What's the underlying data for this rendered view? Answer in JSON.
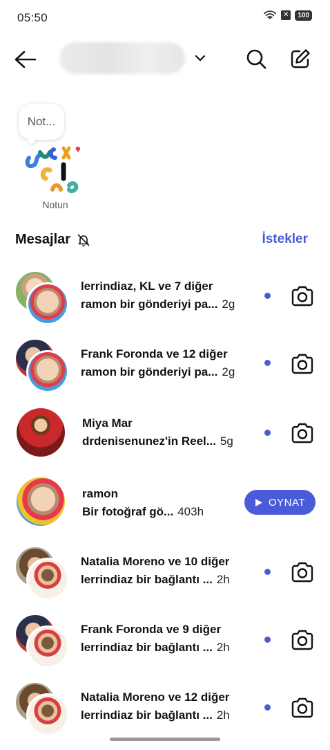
{
  "status": {
    "time": "05:50",
    "battery": "100",
    "sim": "✕"
  },
  "notes": {
    "bubble": "Not...",
    "label": "Notun"
  },
  "section": {
    "title": "Mesajlar",
    "requests": "İstekler"
  },
  "threads": [
    {
      "name": "lerrindiaz, KL ve 7 diğer",
      "message": "ramon bir gönderiyi pa...",
      "time": "2g",
      "unread": true,
      "action": "camera"
    },
    {
      "name": "Frank Foronda ve 12 diğer",
      "message": "ramon bir gönderiyi pa...",
      "time": "2g",
      "unread": true,
      "action": "camera"
    },
    {
      "name": "Miya Mar",
      "message": "drdenisenunez'in Reel...",
      "time": "5g",
      "unread": true,
      "action": "camera"
    },
    {
      "name": "ramon",
      "message": "Bir fotoğraf gö...",
      "time": "403h",
      "unread": false,
      "action": "play",
      "play_label": "OYNAT"
    },
    {
      "name": "Natalia Moreno ve 10 diğer",
      "message": "lerrindiaz bir bağlantı ...",
      "time": "2h",
      "unread": true,
      "action": "camera"
    },
    {
      "name": "Frank Foronda ve 9 diğer",
      "message": "lerrindiaz bir bağlantı ...",
      "time": "2h",
      "unread": true,
      "action": "camera"
    },
    {
      "name": "Natalia Moreno ve 12 diğer",
      "message": "lerrindiaz bir bağlantı ...",
      "time": "2h",
      "unread": true,
      "action": "camera"
    }
  ],
  "colors": {
    "accent": "#4a5bd9",
    "unread_dot": "#4f5bd5"
  }
}
